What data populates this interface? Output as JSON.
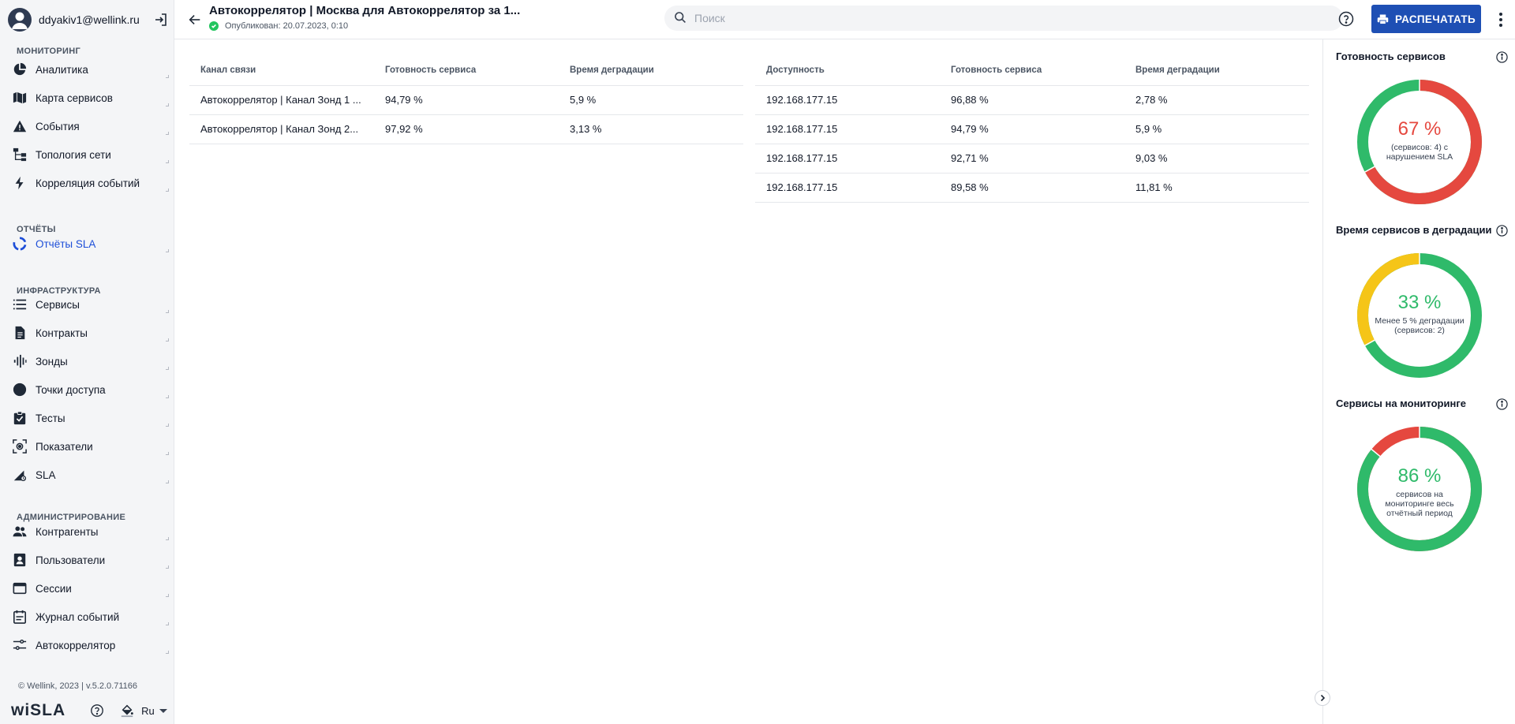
{
  "user": {
    "email": "ddyakiv1@wellink.ru"
  },
  "sidebar": {
    "sections": [
      {
        "title": "МОНИТОРИНГ",
        "items": [
          {
            "label": "Аналитика",
            "icon": "pie-chart-icon"
          },
          {
            "label": "Карта сервисов",
            "icon": "map-icon"
          },
          {
            "label": "События",
            "icon": "warning-icon"
          },
          {
            "label": "Топология сети",
            "icon": "topology-icon"
          },
          {
            "label": "Корреляция событий",
            "icon": "lightning-icon"
          }
        ]
      },
      {
        "title": "ОТЧЁТЫ",
        "items": [
          {
            "label": "Отчёты SLA",
            "icon": "report-ring-icon",
            "active": true
          }
        ]
      },
      {
        "title": "ИНФРАСТРУКТУРА",
        "items": [
          {
            "label": "Сервисы",
            "icon": "list-icon"
          },
          {
            "label": "Контракты",
            "icon": "document-icon"
          },
          {
            "label": "Зонды",
            "icon": "waveform-icon"
          },
          {
            "label": "Точки доступа",
            "icon": "circle-icon"
          },
          {
            "label": "Тесты",
            "icon": "clipboard-check-icon"
          },
          {
            "label": "Показатели",
            "icon": "metrics-icon"
          },
          {
            "label": "SLA",
            "icon": "sla-icon"
          }
        ]
      },
      {
        "title": "АДМИНИСТРИРОВАНИЕ",
        "items": [
          {
            "label": "Контрагенты",
            "icon": "people-icon"
          },
          {
            "label": "Пользователи",
            "icon": "user-badge-icon"
          },
          {
            "label": "Сессии",
            "icon": "window-icon"
          },
          {
            "label": "Журнал событий",
            "icon": "journal-icon"
          },
          {
            "label": "Автокоррелятор",
            "icon": "sliders-icon"
          }
        ]
      }
    ],
    "copyright": "© Wellink, 2023 | v.5.2.0.71166",
    "logo": "wiSLA",
    "language": "Ru"
  },
  "header": {
    "title": "Автокоррелятор | Москва для Автокоррелятор за 1...",
    "published": "Опубликован: 20.07.2023, 0:10",
    "search_placeholder": "Поиск",
    "print_label": "РАСПЕЧАТАТЬ"
  },
  "table_left": {
    "headers": [
      "Канал связи",
      "Готовность сервиса",
      "Время деградации"
    ],
    "rows": [
      [
        "Автокоррелятор | Канал Зонд 1 ...",
        "94,79 %",
        "5,9 %"
      ],
      [
        "Автокоррелятор | Канал Зонд 2...",
        "97,92 %",
        "3,13 %"
      ]
    ]
  },
  "table_right": {
    "headers": [
      "Доступность",
      "Готовность сервиса",
      "Время деградации"
    ],
    "rows": [
      [
        "192.168.177.15",
        "96,88 %",
        "2,78 %"
      ],
      [
        "192.168.177.15",
        "94,79 %",
        "5,9 %"
      ],
      [
        "192.168.177.15",
        "92,71 %",
        "9,03 %"
      ],
      [
        "192.168.177.15",
        "89,58 %",
        "11,81 %"
      ]
    ]
  },
  "widgets": [
    {
      "title": "Готовность сервисов",
      "value": "67 %",
      "caption": "(сервисов: 4) с нарушением SLA",
      "fraction": 0.67,
      "main_color": "#e5483f",
      "rest_color": "#2fba6a",
      "value_color": "#e5483f"
    },
    {
      "title": "Время сервисов в деградации",
      "value": "33 %",
      "caption": "Менее 5 % деградации (сервисов: 2)",
      "fraction": 0.33,
      "main_color": "#f5c518",
      "rest_color": "#2fba6a",
      "value_color": "#2fba6a",
      "main_first_reverse": true
    },
    {
      "title": "Сервисы на мониторинге",
      "value": "86 %",
      "caption": "сервисов на мониторинге весь отчётный период",
      "fraction": 0.86,
      "main_color": "#2fba6a",
      "rest_color": "#e5483f",
      "value_color": "#2fba6a"
    }
  ],
  "colors": {
    "accent": "#1e4fb4",
    "green": "#2fba6a",
    "red": "#e5483f",
    "yellow": "#f5c518"
  }
}
